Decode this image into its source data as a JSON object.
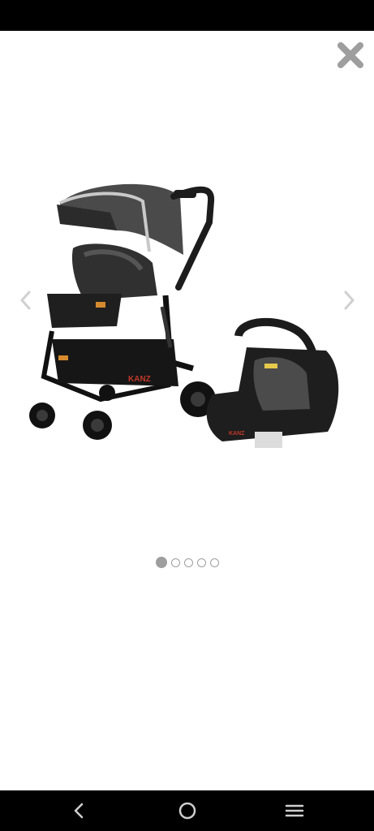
{
  "status_bar": {},
  "viewer": {
    "close_icon": "close-icon",
    "prev_icon": "chevron-left-icon",
    "next_icon": "chevron-right-icon",
    "image": {
      "subject": "product-photo",
      "brand_label": "KANZ"
    },
    "pagination": {
      "total": 5,
      "active_index": 0
    }
  },
  "nav_bar": {
    "back_icon": "back-icon",
    "home_icon": "home-icon",
    "recents_icon": "recents-icon"
  },
  "colors": {
    "close_icon": "#9e9e9e",
    "dot": "#9e9e9e",
    "system_bar": "#000000",
    "nav_icon": "#cfcfcf"
  }
}
